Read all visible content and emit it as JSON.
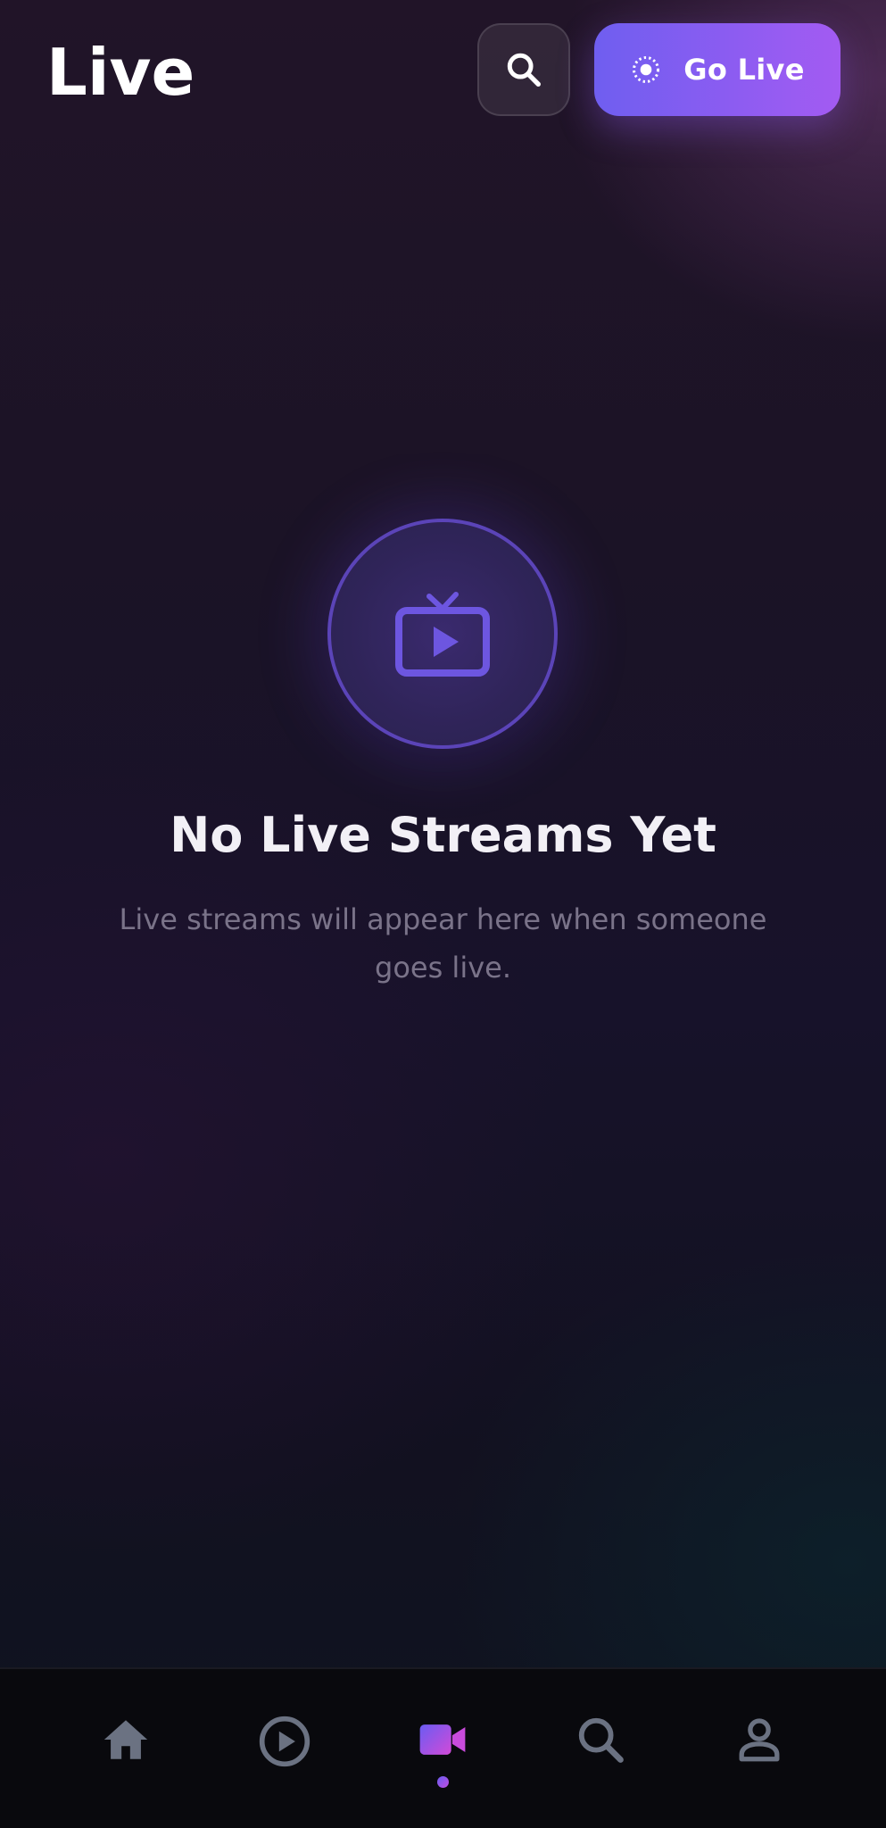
{
  "header": {
    "title": "Live",
    "search_icon": "search-icon",
    "go_live_label": "Go Live",
    "go_live_icon": "live-broadcast-icon"
  },
  "empty_state": {
    "icon": "tv-play-icon",
    "title": "No Live Streams Yet",
    "subtitle": "Live streams will appear here when someone goes live."
  },
  "bottom_nav": {
    "items": [
      {
        "icon": "home-icon",
        "active": false
      },
      {
        "icon": "play-circle-icon",
        "active": false
      },
      {
        "icon": "video-camera-icon",
        "active": true
      },
      {
        "icon": "search-icon",
        "active": false
      },
      {
        "icon": "profile-icon",
        "active": false
      }
    ]
  },
  "colors": {
    "accent_start": "#6f5ef0",
    "accent_end": "#a35bf2",
    "nav_inactive": "#6b7282",
    "ring_border": "#5b44b8",
    "icon_purple": "#6d56e0"
  }
}
